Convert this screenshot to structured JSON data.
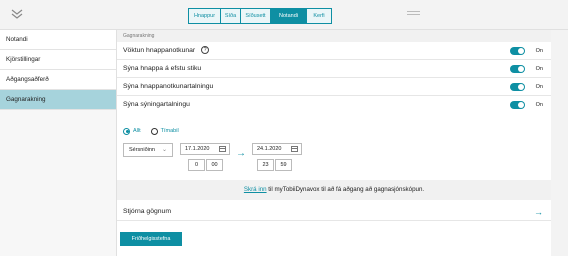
{
  "header": {
    "collapse_icon": "double-chevron-down-icon",
    "tabs": [
      {
        "label": "Hnappur",
        "active": false
      },
      {
        "label": "Síða",
        "active": false
      },
      {
        "label": "Síðusett",
        "active": false
      },
      {
        "label": "Notandi",
        "active": true
      },
      {
        "label": "Kerfi",
        "active": false
      }
    ],
    "menu_icon": "hamburger-icon"
  },
  "sidebar": {
    "items": [
      {
        "label": "Notandi"
      },
      {
        "label": "Kjörstillingar"
      },
      {
        "label": "Aðgangsaðferð"
      },
      {
        "label": "Gagnarakning"
      }
    ]
  },
  "main": {
    "section_title": "Gagnarakning",
    "rows": [
      {
        "label": "Vöktun hnappanotkunar",
        "state": "On",
        "has_help": true
      },
      {
        "label": "Sýna hnappa á efstu stiku",
        "state": "On"
      },
      {
        "label": "Sýna hnappanotkunartalningu",
        "state": "On"
      },
      {
        "label": "Sýna sýningartalningu",
        "state": "On"
      }
    ],
    "range": {
      "option_all": "Allt",
      "option_time": "Tímabil",
      "selected": "Allt",
      "period_select": "Sérsniðinn",
      "from_date": "17.1.2020",
      "from_hour": "0",
      "from_minute": "00",
      "to_date": "24.1.2020",
      "to_hour": "23",
      "to_minute": "59"
    },
    "banner": {
      "link": "Skrá inn",
      "text": " til myTobiiDynavox til að fá aðgang að gagnasjónskópun."
    },
    "manage_data": "Stjórna gögnum",
    "privacy_button": "Friðhelgisstefna"
  },
  "colors": {
    "accent": "#0e8fa3",
    "sidebar_active": "#a6d3dc"
  }
}
